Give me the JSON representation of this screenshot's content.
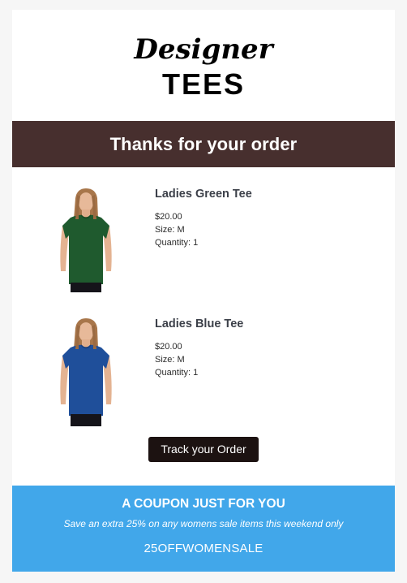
{
  "brand": {
    "script_word": "Designer",
    "block_word": "TEES"
  },
  "banner": {
    "title": "Thanks for your order"
  },
  "items": [
    {
      "name": "Ladies Green Tee",
      "price": "$20.00",
      "size": "Size: M",
      "quantity": "Quantity: 1",
      "shirt_color": "#1f5a2e"
    },
    {
      "name": "Ladies Blue Tee",
      "price": "$20.00",
      "size": "Size: M",
      "quantity": "Quantity: 1",
      "shirt_color": "#1f4f9a"
    }
  ],
  "track_button": {
    "label": "Track your Order"
  },
  "coupon": {
    "title": "A COUPON JUST FOR YOU",
    "subtitle": "Save an extra 25% on any womens sale items this weekend only",
    "code": "25OFFWOMENSALE"
  },
  "colors": {
    "banner_bg": "#472f2e",
    "button_bg": "#1c1211",
    "coupon_bg": "#41a7ea"
  }
}
